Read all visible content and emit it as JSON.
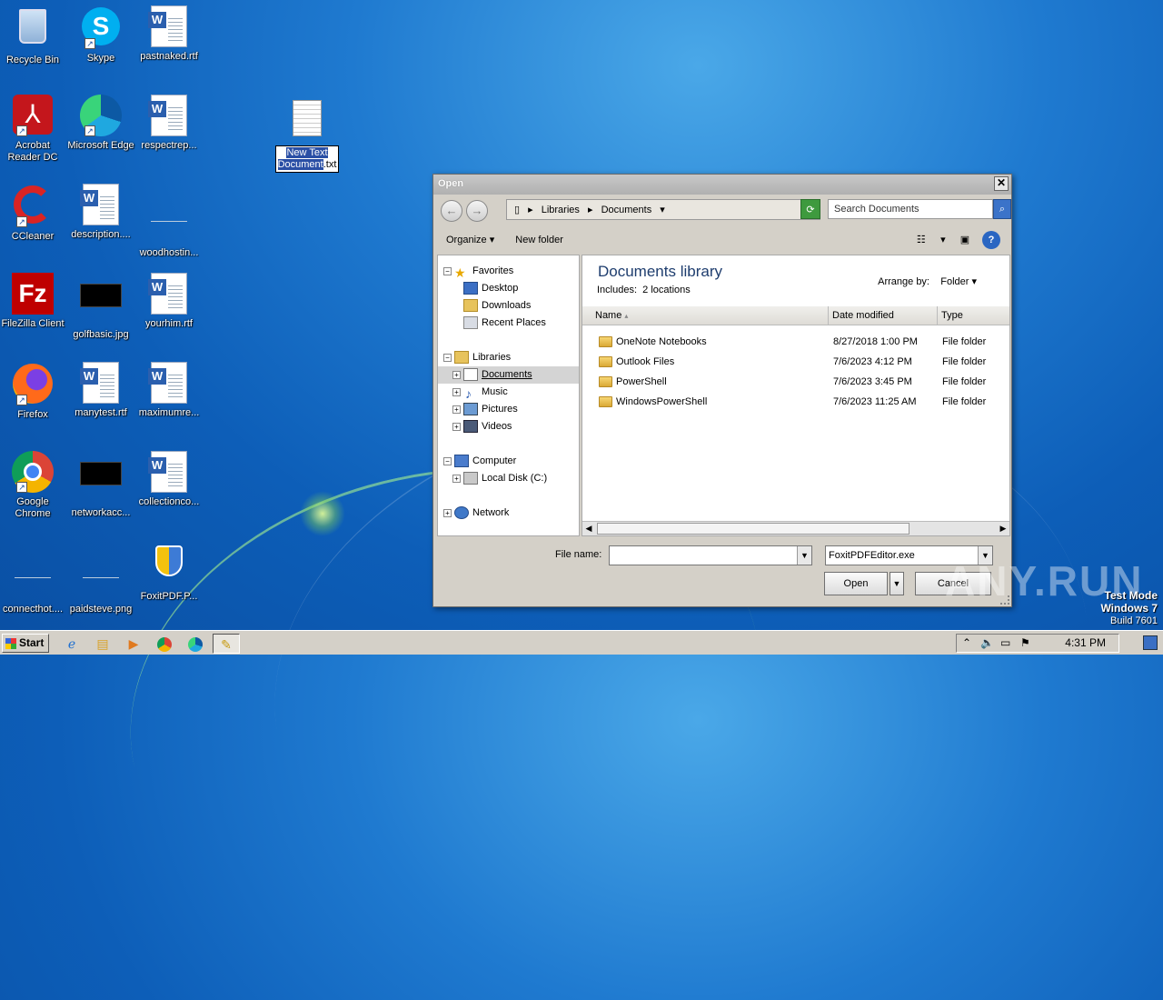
{
  "desktop": {
    "icons": [
      {
        "label": "Recycle Bin"
      },
      {
        "label": "Skype"
      },
      {
        "label": "pastnaked.rtf"
      },
      {
        "label": "Acrobat Reader DC"
      },
      {
        "label": "Microsoft Edge"
      },
      {
        "label": "respectrep..."
      },
      {
        "label": "CCleaner"
      },
      {
        "label": "description...."
      },
      {
        "label": "woodhostin..."
      },
      {
        "label": "FileZilla Client"
      },
      {
        "label": "golfbasic.jpg"
      },
      {
        "label": "yourhim.rtf"
      },
      {
        "label": "Firefox"
      },
      {
        "label": "manytest.rtf"
      },
      {
        "label": "maximumre..."
      },
      {
        "label": "Google Chrome"
      },
      {
        "label": "networkacc..."
      },
      {
        "label": "collectionco..."
      },
      {
        "label": "connecthot...."
      },
      {
        "label": "paidsteve.png"
      },
      {
        "label": "FoxitPDF.P..."
      }
    ],
    "renaming_file": {
      "line1": "New Text",
      "line2_selected": "Document",
      "line2_ext": ".txt"
    }
  },
  "dialog": {
    "title": "Open",
    "close": "✕",
    "breadcrumb": [
      "Libraries",
      "Documents"
    ],
    "search_placeholder": "Search Documents",
    "toolbar": {
      "organize": "Organize",
      "new_folder": "New folder"
    },
    "nav": [
      {
        "label": "Favorites"
      },
      {
        "label": "Desktop"
      },
      {
        "label": "Downloads"
      },
      {
        "label": "Recent Places"
      },
      {
        "label": "Libraries"
      },
      {
        "label": "Documents"
      },
      {
        "label": "Music"
      },
      {
        "label": "Pictures"
      },
      {
        "label": "Videos"
      },
      {
        "label": "Computer"
      },
      {
        "label": "Local Disk (C:)"
      },
      {
        "label": "Network"
      }
    ],
    "library_title": "Documents library",
    "library_includes": "Includes:",
    "library_locations": "2 locations",
    "arrange_label": "Arrange by:",
    "arrange_value": "Folder",
    "columns": {
      "name": "Name",
      "date": "Date modified",
      "type": "Type"
    },
    "files": [
      {
        "name": "OneNote Notebooks",
        "date": "8/27/2018 1:00 PM",
        "type": "File folder"
      },
      {
        "name": "Outlook Files",
        "date": "7/6/2023 4:12 PM",
        "type": "File folder"
      },
      {
        "name": "PowerShell",
        "date": "7/6/2023 3:45 PM",
        "type": "File folder"
      },
      {
        "name": "WindowsPowerShell",
        "date": "7/6/2023 11:25 AM",
        "type": "File folder"
      }
    ],
    "file_name_label": "File name:",
    "file_name_value": "",
    "file_type_value": "FoxitPDFEditor.exe",
    "open_button": "Open",
    "cancel_button": "Cancel"
  },
  "watermark": {
    "brand": "ANY.RUN",
    "test_mode": "Test Mode",
    "os": "Windows 7",
    "build": "Build 7601"
  },
  "taskbar": {
    "start": "Start",
    "time": "4:31 PM"
  }
}
